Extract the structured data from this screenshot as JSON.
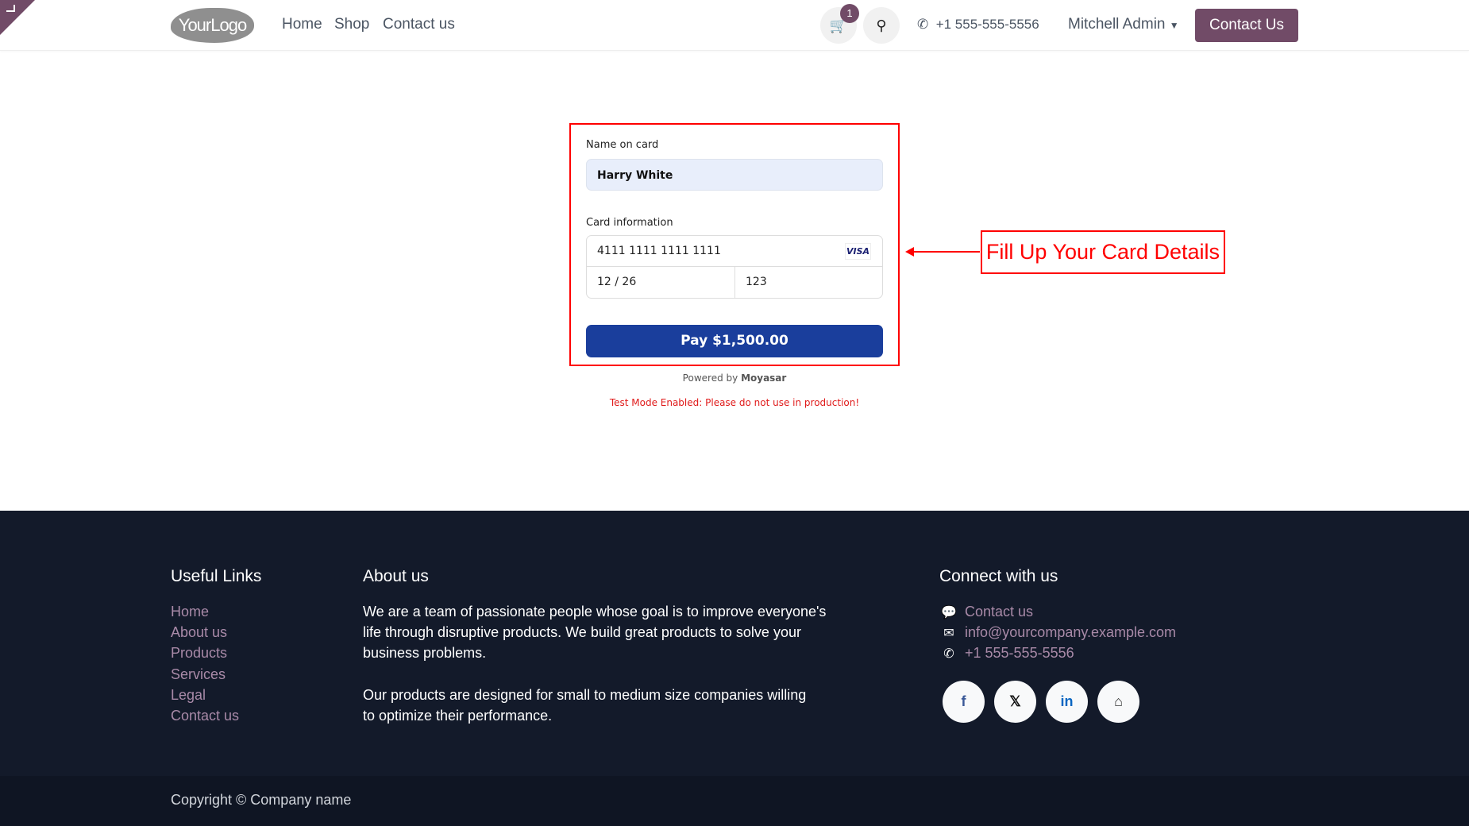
{
  "header": {
    "logo": "YourLogo",
    "nav": [
      "Home",
      "Shop",
      "Contact us"
    ],
    "cart_count": "1",
    "phone": "+1 555-555-5556",
    "user": "Mitchell Admin",
    "contact_button": "Contact Us"
  },
  "payment": {
    "name_label": "Name on card",
    "name_value": "Harry White",
    "card_label": "Card information",
    "card_number": "4111 1111 1111 1111",
    "card_brand": "VISA",
    "expiry": "12 / 26",
    "cvc": "123",
    "pay_button": "Pay $1,500.00",
    "powered_by": "Powered by",
    "provider": "Moyasar",
    "test_notice": "Test Mode Enabled: Please do not use in production!"
  },
  "annotation": {
    "text": "Fill Up Your Card Details",
    "color": "#ff0000"
  },
  "footer": {
    "useful_title": "Useful Links",
    "useful_links": [
      "Home",
      "About us",
      "Products",
      "Services",
      "Legal",
      "Contact us"
    ],
    "about_title": "About us",
    "about_p1": "We are a team of passionate people whose goal is to improve everyone's life through disruptive products. We build great products to solve your business problems.",
    "about_p2": "Our products are designed for small to medium size companies willing to optimize their performance.",
    "connect_title": "Connect with us",
    "contact_link": "Contact us",
    "email": "info@yourcompany.example.com",
    "phone": "+1 555-555-5556",
    "social": [
      "facebook",
      "x",
      "linkedin",
      "home"
    ],
    "copyright": "Copyright © Company name"
  },
  "colors": {
    "brand": "#714b67",
    "pay_button": "#1a3e9c",
    "footer_bg": "#131a2a"
  }
}
